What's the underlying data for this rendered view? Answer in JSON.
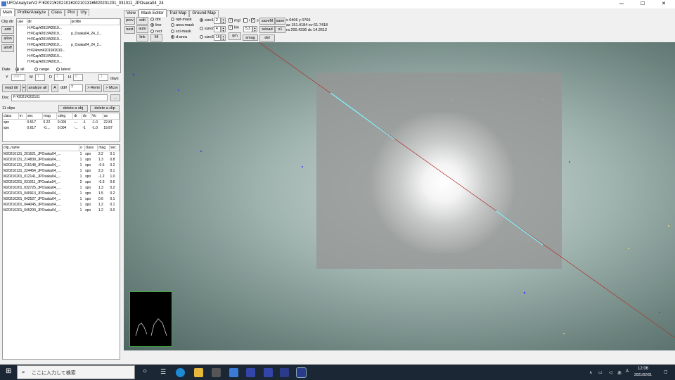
{
  "window": {
    "title": "UFOAnalyzerV2 F:¥2021¥202101¥20210131¥M20201201_031011_JPOsaka04_24",
    "min": "─",
    "max": "☐",
    "close": "✕"
  },
  "left": {
    "tabs": [
      "Main",
      "Profile/Analyze",
      "Class",
      "Plot",
      "Uty"
    ],
    "clipdir": {
      "label": "Clip dir",
      "add": "add",
      "allon": "allon",
      "alloff": "alloff",
      "headers": [
        "use",
        "dir",
        "profile"
      ],
      "rows": [
        [
          "",
          "H:¥Cap¥2019¥2019...",
          ""
        ],
        [
          "",
          "H:¥Cap¥2019¥2019...",
          "p_Osaka04_24_2..."
        ],
        [
          "",
          "H:¥Cap¥2019¥2019...",
          ""
        ],
        [
          "",
          "H:¥Cap¥2019¥2019...",
          "p_Osaka04_24_2..."
        ],
        [
          "",
          "H:¥24mm¥2019¥2019...",
          ""
        ],
        [
          "",
          "H:¥Cap¥2019¥2019...",
          ""
        ],
        [
          "",
          "H:¥Cap¥2019¥2019...",
          ""
        ]
      ]
    },
    "date": {
      "label": "Date",
      "all": "all",
      "range": "range",
      "latest": "latest",
      "y": "Y",
      "y_val": "2007",
      "m": "M",
      "m_val": "1",
      "d": "D",
      "d_val": "1",
      "h": "H",
      "h_val": "0",
      "dash": "-",
      "days_val": "1",
      "days": "days"
    },
    "actions": {
      "readdir": "read dir",
      "plus": "+",
      "analyze": "analyze all",
      "a": "A",
      "ddif": "ddif",
      "ddif_val": "7",
      "remi": "> Remi",
      "mcsv": "> Mcsv"
    },
    "doc": {
      "label": "Doc",
      "value": "F:¥2021¥202101",
      "browse": "..."
    },
    "objects": {
      "count": "11 clips",
      "del_obj": "delete a obj",
      "del_clip": "delete a clip",
      "headers": [
        "class",
        "m",
        "sec",
        "mag",
        "cdeg",
        "dr",
        "dv",
        "Vo",
        "av"
      ],
      "rows": [
        [
          "spo",
          "",
          "0.517",
          "0.22",
          "0.005",
          "-...",
          "-1",
          "-1.0",
          "22.81"
        ],
        [
          "spo",
          "",
          "0.617",
          "-0....",
          "0.004",
          "-...",
          "-1",
          "-1.0",
          "19.87"
        ]
      ]
    },
    "clips": {
      "headers": [
        "clip_name",
        "o",
        "class",
        "mag",
        "sec"
      ],
      "rows": [
        [
          "M20210131_201621_JPOsaka04_...",
          "1",
          "spo",
          "2.2",
          "0.1"
        ],
        [
          "M20210131_214839_JPOsaka04_...",
          "1",
          "spo",
          "1.3",
          "0.8"
        ],
        [
          "M20210131_215148_JPOsaka04_...",
          "1",
          "spo",
          "-0.6",
          "0.2"
        ],
        [
          "M20210131_224454_JPOsaka04_...",
          "1",
          "spo",
          "2.3",
          "0.1"
        ],
        [
          "M20210201_012141_JPOsaka04_...",
          "1",
          "spo",
          "-1.2",
          "1.0"
        ],
        [
          "M20210201_031011_JPOsaka04_...",
          "2",
          "spo",
          "-0.3",
          "0.6"
        ],
        [
          "M20210201_032725_JPOsaka04_...",
          "1",
          "spo",
          "1.3",
          "0.2"
        ],
        [
          "M20210201_040913_JPOsaka04_...",
          "1",
          "spo",
          "1.5",
          "0.2"
        ],
        [
          "M20210201_042527_JPOsaka04_...",
          "1",
          "spo",
          "0.6",
          "0.1"
        ],
        [
          "M20210201_044045_JPOsaka04_...",
          "1",
          "spo",
          "1.2",
          "0.1"
        ],
        [
          "M20210201_045200_JPOsaka04_...",
          "1",
          "spo",
          "1.2",
          "0.0"
        ]
      ]
    }
  },
  "right": {
    "tabs": [
      "View",
      "Mask Editor",
      "Trail Map",
      "Ground Map"
    ],
    "prev": "prev",
    "next": "next",
    "edit": "edit",
    "auto": "auto",
    "link": "link",
    "fill": "fill",
    "mode": {
      "dot": "dot",
      "line": "line",
      "rect": "rect"
    },
    "masks": {
      "opt": "opt-mask",
      "area": "area-mask",
      "scl": "scl-mask",
      "darea": "d-area"
    },
    "sizes": {
      "size1": "size1",
      "size1_val": "2",
      "size2": "size2",
      "size2_val": "4",
      "size3": "size3",
      "size3_val": "16"
    },
    "mgl": "mgl",
    "lim": "lim",
    "r": "r",
    "s": "s",
    "zoom_val": "5.3",
    "qm": "qm",
    "smag": "smag",
    "savem": "saveM",
    "reload": "reload",
    "del": "del",
    "save": "save",
    "x1": "x1",
    "coords": {
      "l1": "x 0406  y 0766",
      "l2": "az 151.4184 ev 61.7418",
      "l3": "ra 200.4336 dc 14.2612"
    }
  },
  "taskbar": {
    "search": "ここに入力して検索",
    "time": "12:06",
    "date": "2021/02/01",
    "lang": "A",
    "ime": "あ"
  }
}
